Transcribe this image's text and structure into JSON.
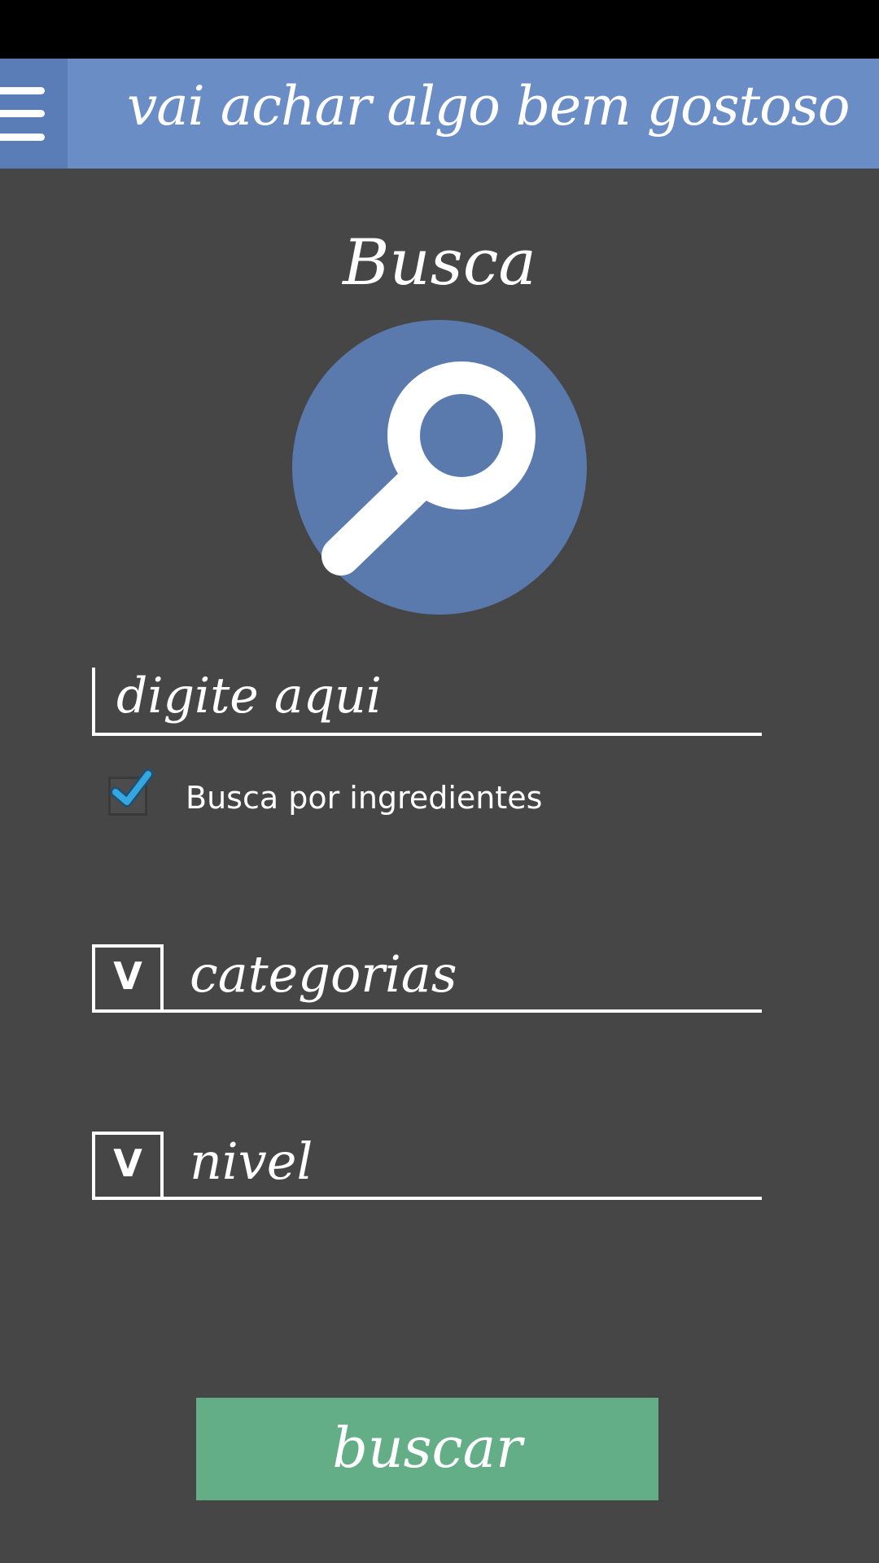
{
  "header": {
    "title": "vai achar algo bem gostoso",
    "menu_icon": "hamburger-menu-icon",
    "color": "#6b8dc5"
  },
  "main": {
    "page_title": "Busca",
    "hero_icon": "magnifier-icon",
    "hero_color": "#5a7aae",
    "search": {
      "placeholder": "digite aqui"
    },
    "ingredient_checkbox": {
      "label": "Busca por ingredientes",
      "checked": true,
      "check_color": "#35a7e0"
    },
    "categories_dropdown": {
      "chevron": "V",
      "label": "categorias"
    },
    "level_dropdown": {
      "chevron": "V",
      "label": "nivel"
    },
    "submit": {
      "label": "buscar",
      "color": "#63ae87"
    }
  }
}
